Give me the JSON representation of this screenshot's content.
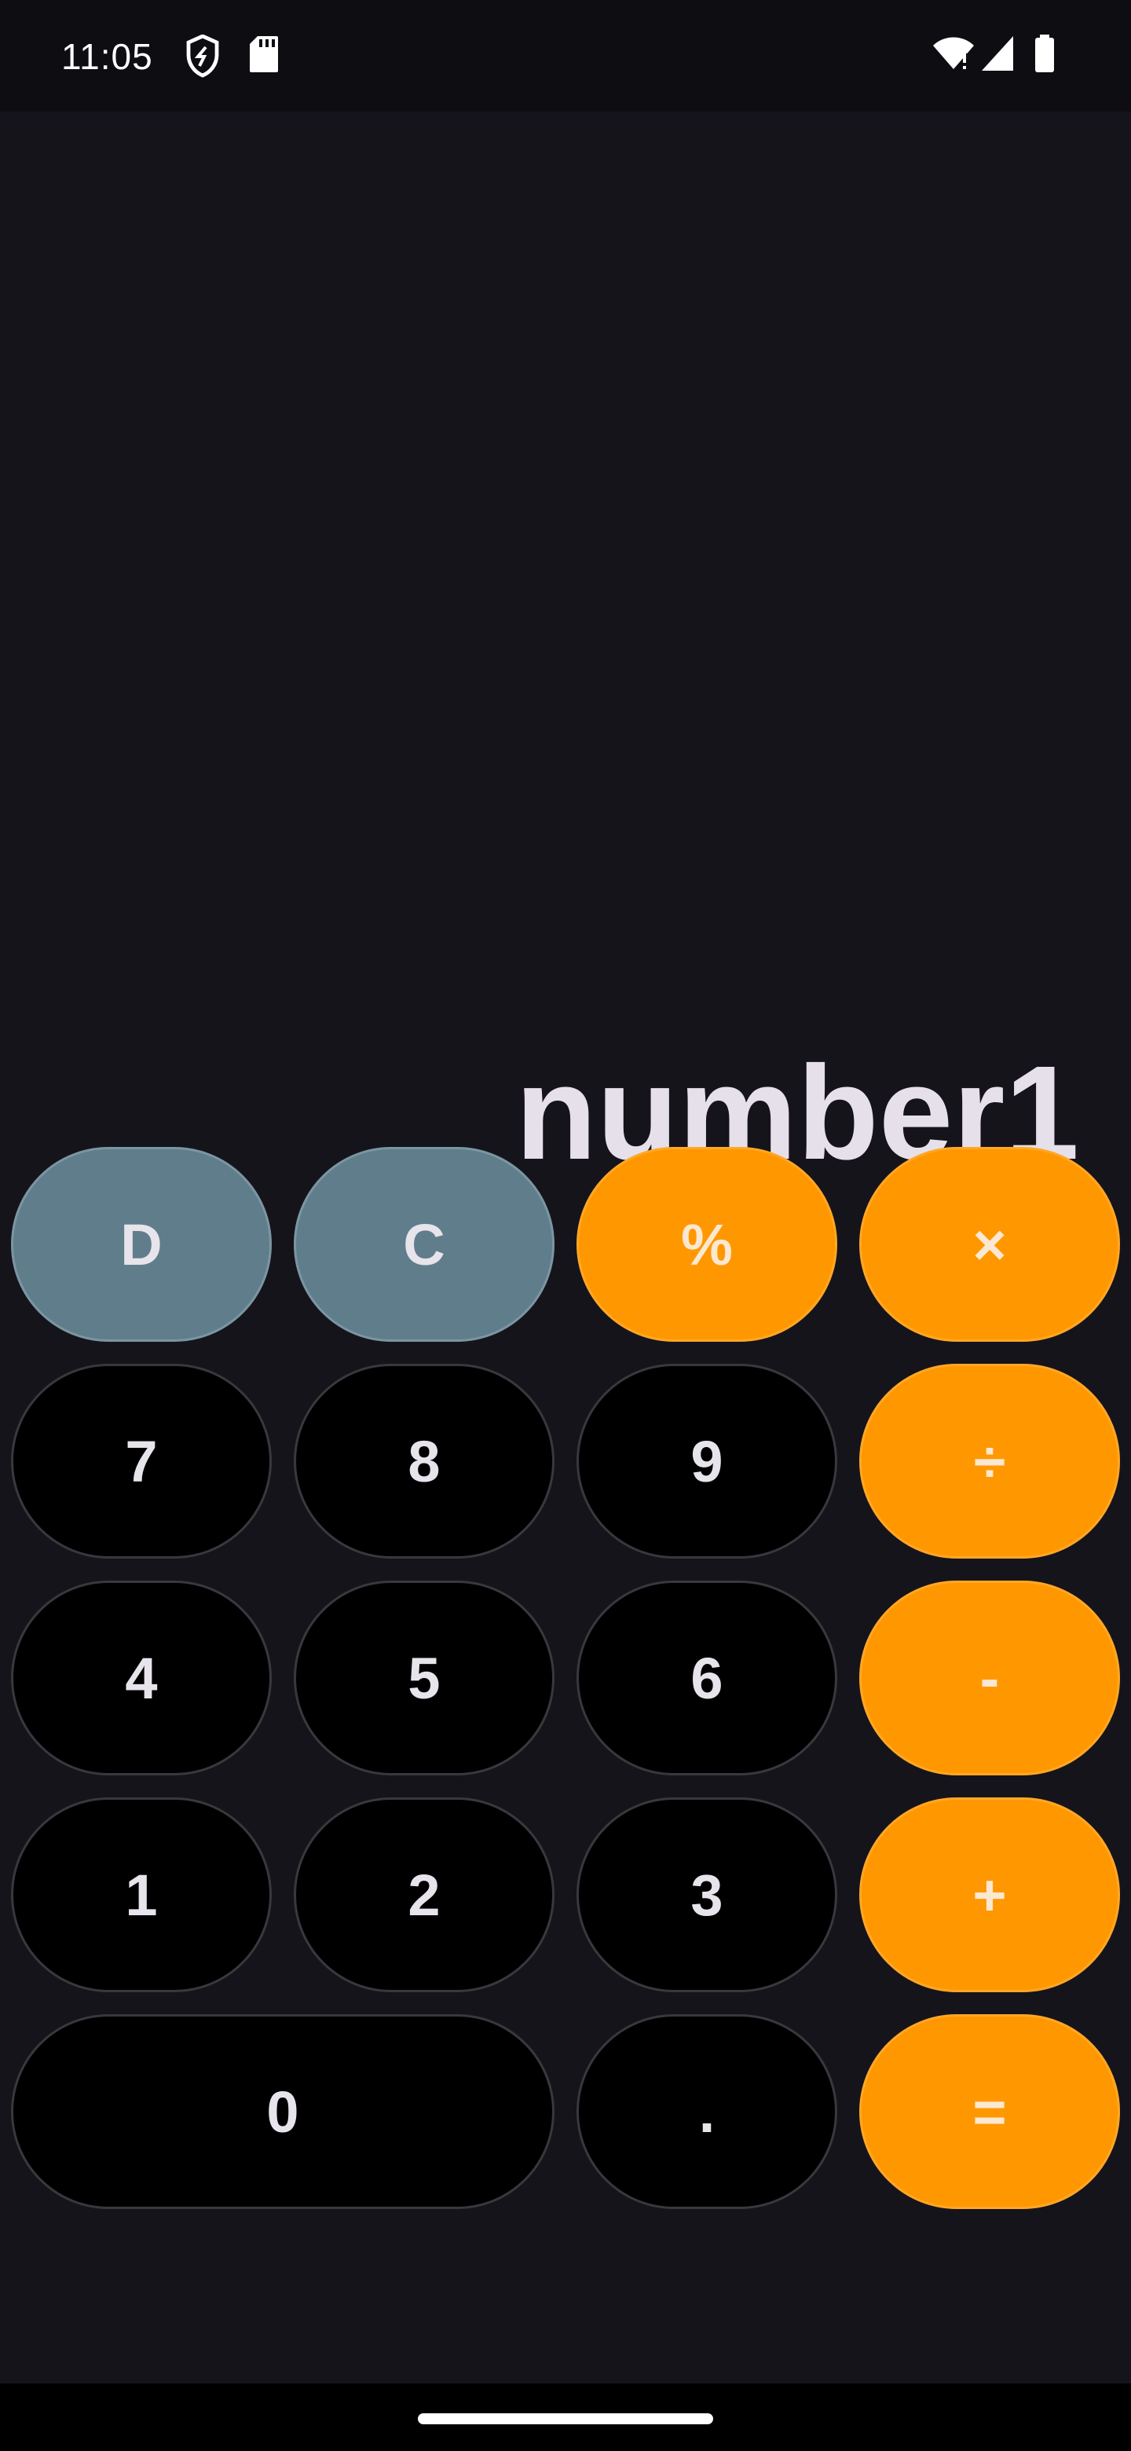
{
  "status_bar": {
    "time": "11:05",
    "icons_left": [
      "shield-icon",
      "sd-card-icon"
    ],
    "icons_right": [
      "wifi-icon",
      "signal-icon",
      "battery-icon"
    ]
  },
  "display": {
    "value": "number1"
  },
  "keys": {
    "delete": "D",
    "clear": "C",
    "percent": "%",
    "multiply": "×",
    "seven": "7",
    "eight": "8",
    "nine": "9",
    "divide": "÷",
    "four": "4",
    "five": "5",
    "six": "6",
    "subtract": "-",
    "one": "1",
    "two": "2",
    "three": "3",
    "add": "+",
    "zero": "0",
    "decimal": ".",
    "equals": "="
  },
  "colors": {
    "background": "#16141b",
    "function_key": "#607d8b",
    "operator_key": "#ff9800",
    "number_key": "#000000",
    "text": "#e6e0ea"
  }
}
